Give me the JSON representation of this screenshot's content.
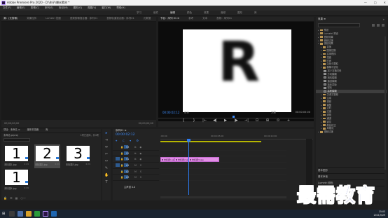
{
  "window": {
    "title": "Adobe Premiere Pro 2020 - D:\\例子\\爆米素材 *",
    "controls": [
      "—",
      "□",
      "✕"
    ]
  },
  "menu": [
    "文件(F)",
    "编辑(E)",
    "剪辑(C)",
    "序列(S)",
    "标记(M)",
    "图形(G)",
    "视图(V)",
    "窗口(W)",
    "帮助(H)"
  ],
  "workspace_tabs": [
    {
      "label": "学习",
      "active": false
    },
    {
      "label": "组件",
      "active": false
    },
    {
      "label": "编辑",
      "active": true
    },
    {
      "label": "颜色",
      "active": false
    },
    {
      "label": "效果",
      "active": false
    },
    {
      "label": "音频",
      "active": false
    },
    {
      "label": "图形",
      "active": false
    },
    {
      "label": "库",
      "active": false
    }
  ],
  "source": {
    "tabs": [
      {
        "label": "源：(无剪辑)",
        "active": true
      },
      {
        "label": "效果控件",
        "active": false
      },
      {
        "label": "Lumetri 范围",
        "active": false
      },
      {
        "label": "音频剪辑混合器：序列01",
        "active": false
      },
      {
        "label": "音频轨道混合器：序列01",
        "active": false
      },
      {
        "label": "元数据",
        "active": false
      }
    ],
    "timecode_left": "00;00;00;00",
    "timecode_right": "00;00;00;00"
  },
  "program": {
    "tabs": [
      {
        "label": "节目：序列 01 ≡",
        "active": true
      },
      {
        "label": "参考",
        "active": false
      },
      {
        "label": "文本",
        "active": false
      },
      {
        "label": "音频：序列01",
        "active": false
      }
    ],
    "frame_glyph": "R",
    "current_timecode": "00:00:02:12",
    "fit": "适合",
    "quality": "完整",
    "duration": "00:00:05:00",
    "transport": [
      "{",
      "}",
      "|←",
      "◀|",
      "▶",
      "|▶",
      "→|",
      "⊡",
      "⊞",
      "⊙",
      "+"
    ]
  },
  "effects": {
    "header": "效果 ≡",
    "items": [
      {
        "label": "预设",
        "level": 0,
        "expanded": false,
        "kind": "folder"
      },
      {
        "label": "Lumetri 预设",
        "level": 0,
        "expanded": false,
        "kind": "folder"
      },
      {
        "label": "音频效果",
        "level": 0,
        "expanded": false,
        "kind": "folder"
      },
      {
        "label": "音频过渡",
        "level": 0,
        "expanded": false,
        "kind": "folder"
      },
      {
        "label": "视频效果",
        "level": 0,
        "expanded": true,
        "kind": "folder"
      },
      {
        "label": "变换",
        "level": 1,
        "expanded": false,
        "kind": "folder"
      },
      {
        "label": "图像控制",
        "level": 1,
        "expanded": false,
        "kind": "folder"
      },
      {
        "label": "实用程序",
        "level": 1,
        "expanded": false,
        "kind": "folder"
      },
      {
        "label": "扭曲",
        "level": 1,
        "expanded": false,
        "kind": "folder"
      },
      {
        "label": "时间",
        "level": 1,
        "expanded": false,
        "kind": "folder"
      },
      {
        "label": "杂色与颗粒",
        "level": 1,
        "expanded": false,
        "kind": "folder"
      },
      {
        "label": "模糊与锐化",
        "level": 1,
        "expanded": true,
        "kind": "folder"
      },
      {
        "label": "减少交错闪烁",
        "level": 2,
        "kind": "fx"
      },
      {
        "label": "方向模糊",
        "level": 2,
        "kind": "fx"
      },
      {
        "label": "相机模糊",
        "level": 2,
        "kind": "fx"
      },
      {
        "label": "通道模糊",
        "level": 2,
        "kind": "fx"
      },
      {
        "label": "钝化蒙版",
        "level": 2,
        "kind": "fx"
      },
      {
        "label": "锐化",
        "level": 2,
        "kind": "fx"
      },
      {
        "label": "高斯模糊",
        "level": 2,
        "kind": "fx",
        "selected": true
      },
      {
        "label": "沉浸式视频",
        "level": 1,
        "expanded": false,
        "kind": "folder"
      },
      {
        "label": "生成",
        "level": 1,
        "expanded": false,
        "kind": "folder"
      },
      {
        "label": "视频",
        "level": 1,
        "expanded": false,
        "kind": "folder"
      },
      {
        "label": "调整",
        "level": 1,
        "expanded": false,
        "kind": "folder"
      },
      {
        "label": "过时",
        "level": 1,
        "expanded": false,
        "kind": "folder"
      },
      {
        "label": "过渡",
        "level": 1,
        "expanded": false,
        "kind": "folder"
      },
      {
        "label": "透视",
        "level": 1,
        "expanded": false,
        "kind": "folder"
      },
      {
        "label": "通道",
        "level": 1,
        "expanded": false,
        "kind": "folder"
      },
      {
        "label": "键控",
        "level": 1,
        "expanded": false,
        "kind": "folder"
      },
      {
        "label": "颜色校正",
        "level": 1,
        "expanded": false,
        "kind": "folder"
      },
      {
        "label": "风格化",
        "level": 1,
        "expanded": false,
        "kind": "folder"
      },
      {
        "label": "视频过渡",
        "level": 0,
        "expanded": false,
        "kind": "folder"
      }
    ],
    "sections": [
      "基本图形",
      "基本声音",
      "Lumetri 颜色",
      "库"
    ]
  },
  "project": {
    "tabs": [
      "项目：未命名 ≡",
      "媒体浏览器",
      "库"
    ],
    "path": "未命名.prproj",
    "count": "1项已选择，共4项",
    "items": [
      {
        "digit": "1",
        "label": "未标题1.jpg",
        "dur": "4:29",
        "selected": false
      },
      {
        "digit": "2",
        "label": "未标题2.jpg",
        "dur": "4:29",
        "selected": true
      },
      {
        "digit": "3",
        "label": "未标题3.jpg",
        "dur": "4:29",
        "selected": false
      },
      {
        "digit": "1",
        "label": "未标题4.jpg",
        "dur": "4:29",
        "selected": false
      }
    ]
  },
  "timeline": {
    "tab": "序列01 ≡",
    "timecode": "00:00:02:12",
    "ruler": [
      ":00:00",
      "00:00:05:00",
      "00:00:10:00"
    ],
    "tracks": [
      {
        "name": "V3",
        "target": false
      },
      {
        "name": "V2",
        "target": false
      },
      {
        "name": "V1",
        "target": true
      },
      {
        "name": "A1",
        "target": true
      },
      {
        "name": "A2",
        "target": false
      },
      {
        "name": "A3",
        "target": false
      }
    ],
    "master_label": "主声道",
    "master_value": "0.0",
    "clips": [
      {
        "label": "未标题1.jpg",
        "track": 3
      },
      {
        "label": "未标题2.jpg",
        "track": 3
      },
      {
        "label": "未标题3.jpg",
        "track": 3
      }
    ]
  },
  "watermark": "最需教育",
  "taskbar": {
    "time": "15:03",
    "date": "2021/5/29"
  },
  "colors": {
    "accent": "#3d8dff",
    "clip": "#e28fe6",
    "workarea": "#b5b500",
    "watermark": "#1c2fa0"
  }
}
